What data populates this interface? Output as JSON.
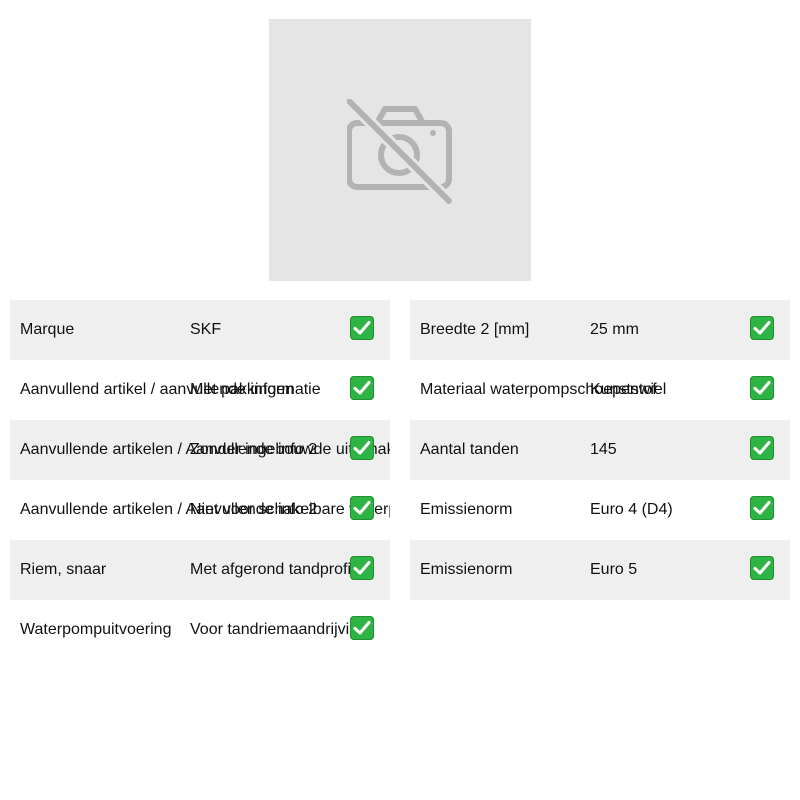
{
  "image": {
    "icon": "no-photo-camera-icon",
    "background": "#e5e5e5"
  },
  "status_icon": "check-mark-icon",
  "accent_color": "#2fb344",
  "left_specs": [
    {
      "label": "Marque",
      "value": "SKF"
    },
    {
      "label": "Aanvullend artikel / aanvullende informatie",
      "value": "Met pakkingen"
    },
    {
      "label": "Aanvullende artikelen / Aanvullende info 2",
      "value": "Zonder ingebouwde uitschakelaar"
    },
    {
      "label": "Aanvullende artikelen / Aanvullende info 2",
      "value": "Niet voor schakelbare waterpompen"
    },
    {
      "label": "Riem, snaar",
      "value": "Met afgerond tandprofiel"
    },
    {
      "label": "Waterpompuitvoering",
      "value": "Voor tandriemaandrijving"
    }
  ],
  "right_specs": [
    {
      "label": "Breedte 2 [mm]",
      "value": "25 mm"
    },
    {
      "label": "Materiaal waterpompschoepenwiel",
      "value": "Kunststof"
    },
    {
      "label": "Aantal tanden",
      "value": "145"
    },
    {
      "label": "Emissienorm",
      "value": "Euro 4 (D4)"
    },
    {
      "label": "Emissienorm",
      "value": "Euro 5"
    }
  ]
}
